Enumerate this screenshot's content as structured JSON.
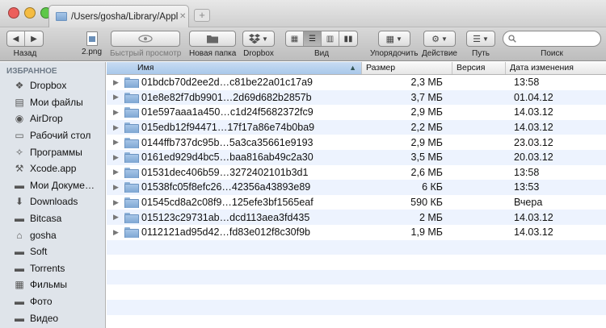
{
  "window": {
    "tab_title": "/Users/gosha/Library/Applicat",
    "tab_close_icon": "close-icon",
    "new_tab_label": "+",
    "colors": {
      "close": "#ec5f5c",
      "minimize": "#f4bc42",
      "zoom": "#5dc848",
      "sort_header": "#b7d1ee",
      "row_alt": "#edf3fe",
      "sidebar": "#dfe4ea"
    }
  },
  "toolbar": {
    "back_label": "Назад",
    "file_label": "2.png",
    "quicklook_label": "Быстрый просмотр",
    "newfolder_label": "Новая папка",
    "dropbox_label": "Dropbox",
    "view_label": "Вид",
    "arrange_label": "Упорядочить",
    "action_label": "Действие",
    "path_label": "Путь",
    "search_label": "Поиск",
    "search_placeholder": ""
  },
  "sidebar": {
    "heading": "ИЗБРАННОЕ",
    "items": [
      {
        "label": "Dropbox",
        "icon": "dropbox-icon"
      },
      {
        "label": "Мои файлы",
        "icon": "files-icon"
      },
      {
        "label": "AirDrop",
        "icon": "airdrop-icon"
      },
      {
        "label": "Рабочий стол",
        "icon": "desktop-icon"
      },
      {
        "label": "Программы",
        "icon": "applications-icon"
      },
      {
        "label": "Xcode.app",
        "icon": "xcode-icon"
      },
      {
        "label": "Мои Докуме…",
        "icon": "folder-icon"
      },
      {
        "label": "Downloads",
        "icon": "downloads-icon"
      },
      {
        "label": "Bitcasa",
        "icon": "folder-icon"
      },
      {
        "label": "gosha",
        "icon": "home-icon"
      },
      {
        "label": "Soft",
        "icon": "folder-icon"
      },
      {
        "label": "Torrents",
        "icon": "folder-icon"
      },
      {
        "label": "Фильмы",
        "icon": "movies-icon"
      },
      {
        "label": "Фото",
        "icon": "folder-icon"
      },
      {
        "label": "Видео",
        "icon": "folder-icon"
      }
    ]
  },
  "list": {
    "columns": {
      "name": "Имя",
      "size": "Размер",
      "version": "Версия",
      "date": "Дата изменения"
    },
    "rows": [
      {
        "name": "01bdcb70d2ee2d…c81be22a01c17a9",
        "size": "2,3 МБ",
        "version": "",
        "date": "13:58"
      },
      {
        "name": "01e8e82f7db9901…2d69d682b2857b",
        "size": "3,7 МБ",
        "version": "",
        "date": "01.04.12"
      },
      {
        "name": "01e597aaa1a450…c1d24f5682372fc9",
        "size": "2,9 МБ",
        "version": "",
        "date": "14.03.12"
      },
      {
        "name": "015edb12f94471…17f17a86e74b0ba9",
        "size": "2,2 МБ",
        "version": "",
        "date": "14.03.12"
      },
      {
        "name": "0144ffb737dc95b…5a3ca35661e9193",
        "size": "2,9 МБ",
        "version": "",
        "date": "23.03.12"
      },
      {
        "name": "0161ed929d4bc5…baa816ab49c2a30",
        "size": "3,5 МБ",
        "version": "",
        "date": "20.03.12"
      },
      {
        "name": "01531dec406b59…3272402101b3d1",
        "size": "2,6 МБ",
        "version": "",
        "date": "13:58"
      },
      {
        "name": "01538fc05f8efc26…42356a43893e89",
        "size": "6 КБ",
        "version": "",
        "date": "13:53"
      },
      {
        "name": "01545cd8a2c08f9…125efe3bf1565eaf",
        "size": "590 КБ",
        "version": "",
        "date": "Вчера"
      },
      {
        "name": "015123c29731ab…dcd113aea3fd435",
        "size": "2 МБ",
        "version": "",
        "date": "14.03.12"
      },
      {
        "name": "0112121ad95d42…fd83e012f8c30f9b",
        "size": "1,9 МБ",
        "version": "",
        "date": "14.03.12"
      }
    ]
  }
}
